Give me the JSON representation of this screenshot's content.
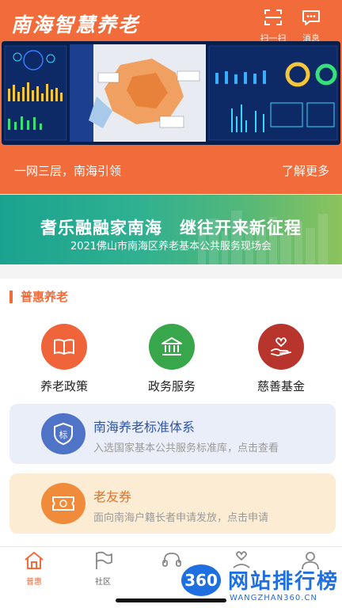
{
  "header": {
    "app_title": "南海智慧养老",
    "scan_label": "扫一扫",
    "message_label": "消息",
    "slogan": "一网三层，南海引领",
    "more_link": "了解更多"
  },
  "promo": {
    "title": "耆乐融融家南海　继往开来新征程",
    "subtitle": "2021佛山市南海区养老基本公共服务现场会"
  },
  "section": {
    "title": "普惠养老",
    "services": [
      {
        "label": "养老政策",
        "icon": "book-icon"
      },
      {
        "label": "政务服务",
        "icon": "government-building-icon"
      },
      {
        "label": "慈善基金",
        "icon": "heart-hand-icon"
      }
    ]
  },
  "features": [
    {
      "title": "南海养老标准体系",
      "desc": "入选国家基本公共服务标准库，点击查看",
      "icon": "standard-badge-icon",
      "badge": "标"
    },
    {
      "title": "老友券",
      "desc": "面向南海户籍长者申请发放，点击申请",
      "icon": "coupon-icon"
    }
  ],
  "nav": [
    {
      "label": "普惠",
      "icon": "home-icon",
      "active": true
    },
    {
      "label": "社区",
      "icon": "flag-icon"
    },
    {
      "label": "",
      "icon": "headset-icon"
    },
    {
      "label": "",
      "icon": "heart-person-icon"
    },
    {
      "label": "",
      "icon": "user-icon"
    }
  ],
  "watermark": {
    "badge": "360",
    "text": "网站排行榜",
    "sub": "WANGZHAN360.CN"
  },
  "colors": {
    "brand": "#f26b3a",
    "policy": "#f0643a",
    "gov": "#38a64a",
    "charity": "#b8352e",
    "standard": "#4f73c6",
    "coupon": "#ef8b3b"
  }
}
